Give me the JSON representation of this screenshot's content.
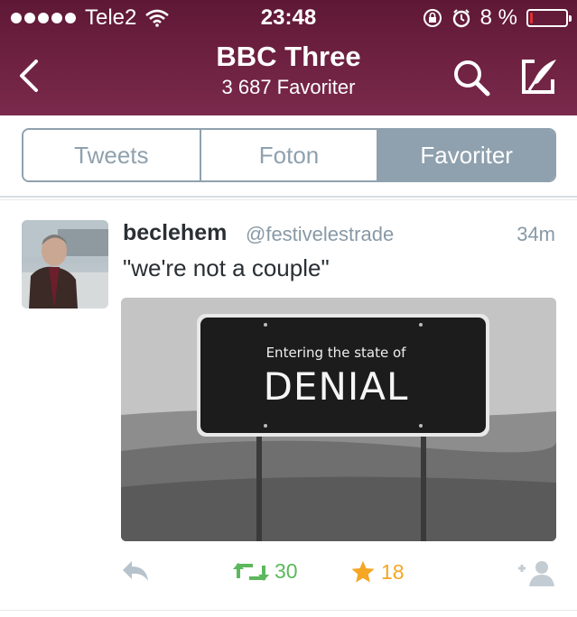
{
  "status_bar": {
    "carrier": "Tele2",
    "time": "23:48",
    "battery_text": "8 %",
    "battery_level": 0.08,
    "signal_bars": 5
  },
  "nav": {
    "title": "BBC Three",
    "subtitle": "3 687 Favoriter",
    "back_icon": "chevron-left-icon",
    "search_icon": "search-icon",
    "compose_icon": "compose-icon"
  },
  "tabs": [
    {
      "label": "Tweets",
      "active": false
    },
    {
      "label": "Foton",
      "active": false
    },
    {
      "label": "Favoriter",
      "active": true
    }
  ],
  "tweet": {
    "name": "beclehem",
    "handle": "@festivelestrade",
    "time_ago": "34m",
    "text": "\"we're not a couple\"",
    "image_sign": {
      "line1": "Entering the state of",
      "line2": "DENIAL"
    },
    "retweets": "30",
    "favorites": "18"
  },
  "colors": {
    "header": "#6b1f3e",
    "segment": "#8fa1ae",
    "retweet": "#5cb85c",
    "favorite": "#f5a623",
    "muted": "#8899a6"
  }
}
